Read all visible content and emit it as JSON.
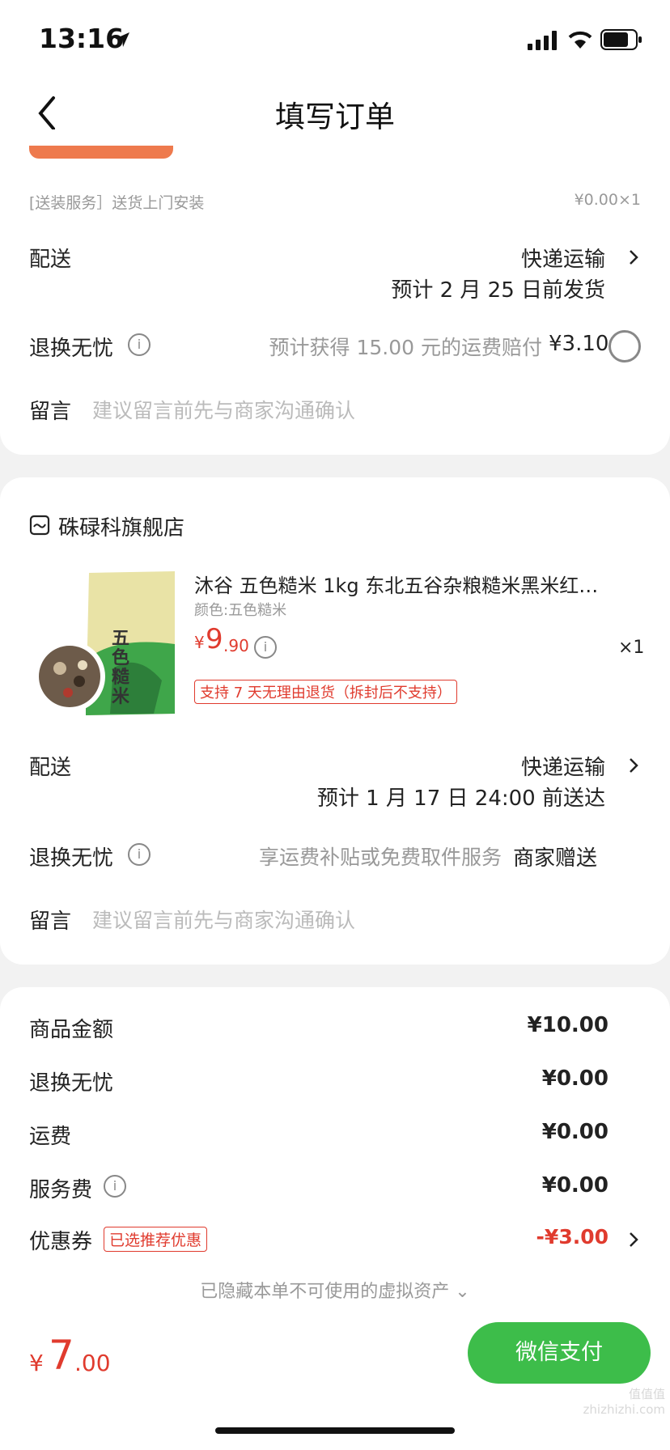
{
  "status": {
    "time": "13:16"
  },
  "nav": {
    "title": "填写订单"
  },
  "order1": {
    "service_label": "[送装服务］送货上门安装",
    "service_price": "¥0.00×1",
    "delivery_label": "配送",
    "delivery_method": "快递运输",
    "delivery_eta": "预计 2 月 25 日前发货",
    "return_label": "退换无忧",
    "return_desc": "预计获得 15.00 元的运费赔付",
    "return_price": "¥3.10",
    "message_label": "留言",
    "message_placeholder": "建议留言前先与商家沟通确认"
  },
  "order2": {
    "shop_name": "硃碌科旗舰店",
    "product": {
      "title": "沐谷 五色糙米 1kg 东北五谷杂粮糙米黑米红…",
      "variant": "颜色:五色糙米",
      "price_symbol": "¥",
      "price_int": "9",
      "price_dec": ".90",
      "qty": "×1",
      "return_tag": "支持 7 天无理由退货（拆封后不支持）",
      "pack_text": "五色糙米"
    },
    "delivery_label": "配送",
    "delivery_method": "快递运输",
    "delivery_eta": "预计 1 月 17 日 24:00 前送达",
    "return_label": "退换无忧",
    "return_desc": "享运费补贴或免费取件服务",
    "return_value": "商家赠送",
    "message_label": "留言",
    "message_placeholder": "建议留言前先与商家沟通确认"
  },
  "summary": {
    "rows": [
      {
        "label": "商品金额",
        "value": "¥10.00"
      },
      {
        "label": "退换无忧",
        "value": "¥0.00"
      },
      {
        "label": "运费",
        "value": "¥0.00"
      },
      {
        "label": "服务费",
        "value": "¥0.00"
      }
    ],
    "coupon_label": "优惠券",
    "coupon_tag": "已选推荐优惠",
    "coupon_value": "-¥3.00",
    "hidden_assets": "已隐藏本单不可使用的虚拟资产"
  },
  "footer": {
    "total_symbol": "¥",
    "total_int": "7",
    "total_dec": ".00",
    "pay_button": "微信支付",
    "watermark": "值值值 zhizhizhi.com"
  },
  "colors": {
    "accent": "#e03b2e",
    "pay": "#3dbd4a",
    "orange": "#ee7a4d"
  }
}
